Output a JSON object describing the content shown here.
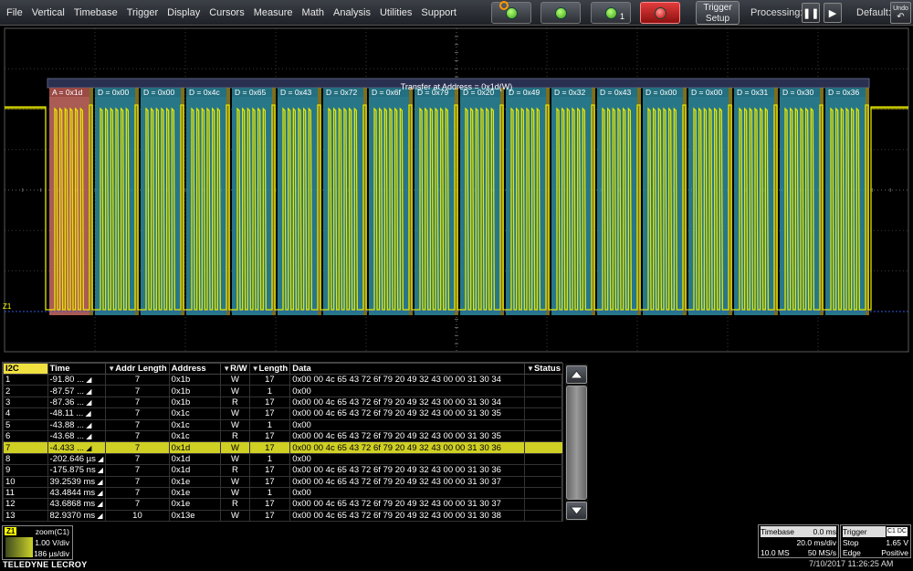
{
  "menubar": {
    "items": [
      "File",
      "Vertical",
      "Timebase",
      "Trigger",
      "Display",
      "Cursors",
      "Measure",
      "Math",
      "Analysis",
      "Utilities",
      "Support"
    ],
    "trigger_setup": {
      "line1": "Trigger",
      "line2": "Setup"
    },
    "processing_label": "Processing:",
    "default_label": "Default:",
    "undo_label": "Undo"
  },
  "waveform": {
    "title": "Transfer at Address = 0x1d(W)",
    "marker": "Z1",
    "segments": [
      "A = 0x1d",
      "D = 0x00",
      "D = 0x00",
      "D = 0x4c",
      "D = 0x65",
      "D = 0x43",
      "D = 0x72",
      "D = 0x6f",
      "D = 0x79",
      "D = 0x20",
      "D = 0x49",
      "D = 0x32",
      "D = 0x43",
      "D = 0x00",
      "D = 0x00",
      "D = 0x31",
      "D = 0x30",
      "D = 0x36"
    ],
    "colors": {
      "address": "#c86b63",
      "data": "#2e8ca0",
      "trace": "#e6e600",
      "grid": "#4a4a4a",
      "cursor": "#3050d0"
    }
  },
  "table": {
    "headers": {
      "i2c": "I2C",
      "time": "Time",
      "addr_length": "Addr Length",
      "address": "Address",
      "rw": "R/W",
      "length": "Length",
      "data": "Data",
      "status": "Status"
    },
    "selected_index": 6,
    "rows": [
      {
        "n": "1",
        "time": "-91.80 ...",
        "addr_len": "7",
        "address": "0x1b",
        "rw": "W",
        "length": "17",
        "data": "0x00 00 4c 65 43 72 6f 79 20 49 32 43 00 00 31 30 34"
      },
      {
        "n": "2",
        "time": "-87.57 ...",
        "addr_len": "7",
        "address": "0x1b",
        "rw": "W",
        "length": "1",
        "data": "0x00"
      },
      {
        "n": "3",
        "time": "-87.36 ...",
        "addr_len": "7",
        "address": "0x1b",
        "rw": "R",
        "length": "17",
        "data": "0x00 00 4c 65 43 72 6f 79 20 49 32 43 00 00 31 30 34"
      },
      {
        "n": "4",
        "time": "-48.11 ...",
        "addr_len": "7",
        "address": "0x1c",
        "rw": "W",
        "length": "17",
        "data": "0x00 00 4c 65 43 72 6f 79 20 49 32 43 00 00 31 30 35"
      },
      {
        "n": "5",
        "time": "-43.88 ...",
        "addr_len": "7",
        "address": "0x1c",
        "rw": "W",
        "length": "1",
        "data": "0x00"
      },
      {
        "n": "6",
        "time": "-43.68 ...",
        "addr_len": "7",
        "address": "0x1c",
        "rw": "R",
        "length": "17",
        "data": "0x00 00 4c 65 43 72 6f 79 20 49 32 43 00 00 31 30 35"
      },
      {
        "n": "7",
        "time": "-4.433 ...",
        "addr_len": "7",
        "address": "0x1d",
        "rw": "W",
        "length": "17",
        "data": "0x00 00 4c 65 43 72 6f 79 20 49 32 43 00 00 31 30 36"
      },
      {
        "n": "8",
        "time": "-202.646 µs",
        "addr_len": "7",
        "address": "0x1d",
        "rw": "W",
        "length": "1",
        "data": "0x00"
      },
      {
        "n": "9",
        "time": "-175.875 ns",
        "addr_len": "7",
        "address": "0x1d",
        "rw": "R",
        "length": "17",
        "data": "0x00 00 4c 65 43 72 6f 79 20 49 32 43 00 00 31 30 36"
      },
      {
        "n": "10",
        "time": "39.2539 ms",
        "addr_len": "7",
        "address": "0x1e",
        "rw": "W",
        "length": "17",
        "data": "0x00 00 4c 65 43 72 6f 79 20 49 32 43 00 00 31 30 37"
      },
      {
        "n": "11",
        "time": "43.4844 ms",
        "addr_len": "7",
        "address": "0x1e",
        "rw": "W",
        "length": "1",
        "data": "0x00"
      },
      {
        "n": "12",
        "time": "43.6868 ms",
        "addr_len": "7",
        "address": "0x1e",
        "rw": "R",
        "length": "17",
        "data": "0x00 00 4c 65 43 72 6f 79 20 49 32 43 00 00 31 30 37"
      },
      {
        "n": "13",
        "time": "82.9370 ms",
        "addr_len": "10",
        "address": "0x13e",
        "rw": "W",
        "length": "17",
        "data": "0x00 00 4c 65 43 72 6f 79 20 49 32 43 00 00 31 30 38"
      }
    ]
  },
  "z1": {
    "tag": "Z1",
    "source": "zoom(C1)",
    "vdiv": "1.00 V/div",
    "tdiv": "186 µs/div"
  },
  "brand": "TELEDYNE LECROY",
  "timebase": {
    "label": "Timebase",
    "offset": "0.0 ms",
    "tdiv": "20.0 ms/div",
    "samples": "10.0 MS",
    "rate": "50 MS/s"
  },
  "trigger": {
    "label": "Trigger",
    "tag": "C1 DC",
    "mode": "Stop",
    "level": "1.65 V",
    "type": "Edge",
    "slope": "Positive"
  },
  "datetime": "7/10/2017 11:26:25 AM"
}
